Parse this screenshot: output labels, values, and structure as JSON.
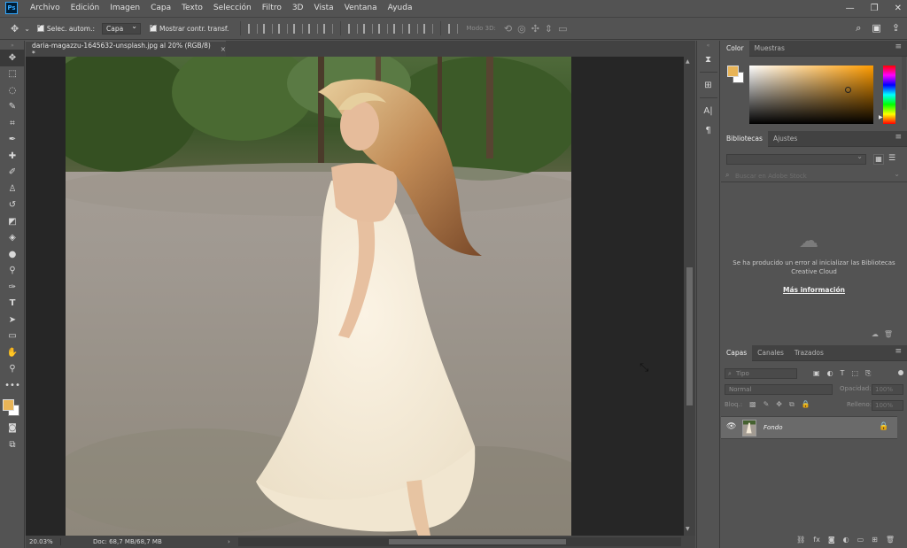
{
  "app": {
    "logo": "Ps"
  },
  "menu": [
    "Archivo",
    "Edición",
    "Imagen",
    "Capa",
    "Texto",
    "Selección",
    "Filtro",
    "3D",
    "Vista",
    "Ventana",
    "Ayuda"
  ],
  "window_controls": {
    "minimize": "—",
    "restore": "❐",
    "close": "✕"
  },
  "options": {
    "auto_select_label": "Selec. autom.:",
    "auto_select_value": "Capa",
    "show_transform_label": "Mostrar contr. transf.",
    "mode3d_label": "Modo 3D:"
  },
  "document": {
    "tab_title": "daria-magazzu-1645632-unsplash.jpg al 20% (RGB/8) *",
    "tab_close": "×",
    "zoom": "20.03%",
    "doc_info": "Doc: 68,7 MB/68,7 MB",
    "status_arrow": "›"
  },
  "colors": {
    "foreground": "#e8b457",
    "background": "#ffffff",
    "hue": "#ff9c00"
  },
  "panels": {
    "color": {
      "tabs": [
        "Color",
        "Muestras"
      ]
    },
    "libraries": {
      "tabs": [
        "Bibliotecas",
        "Ajustes"
      ],
      "search_placeholder": "Buscar en Adobe Stock",
      "error_message": "Se ha producido un error al inicializar las Bibliotecas Creative Cloud",
      "more_info": "Más información"
    },
    "layers": {
      "tabs": [
        "Capas",
        "Canales",
        "Trazados"
      ],
      "filter_placeholder": "Tipo",
      "blend_mode": "Normal",
      "opacity_label": "Opacidad:",
      "opacity_value": "100%",
      "lock_label": "Bloq.:",
      "fill_label": "Relleno:",
      "fill_value": "100%",
      "layer_name": "Fondo"
    }
  }
}
